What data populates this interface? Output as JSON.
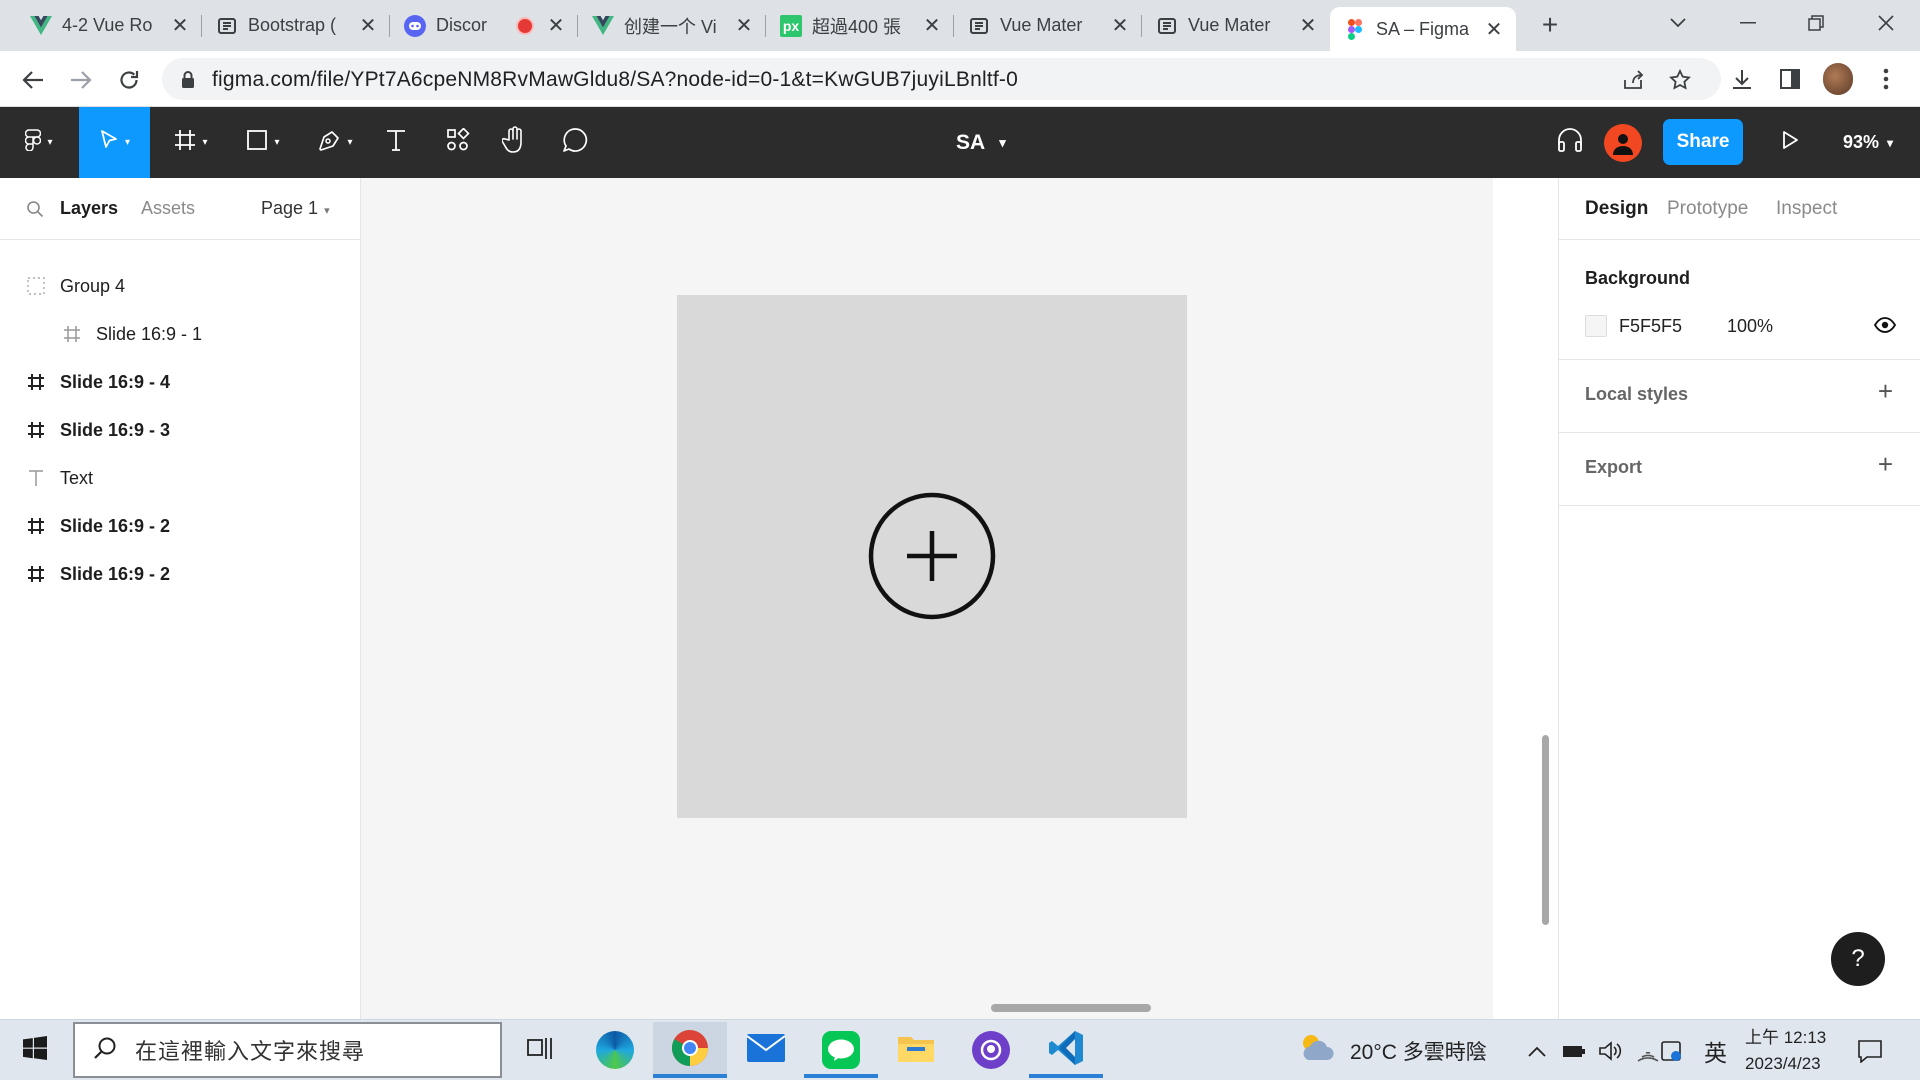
{
  "browser": {
    "tabs": [
      {
        "title": "4-2 Vue Ro",
        "icon": "vue-logo-icon"
      },
      {
        "title": "Bootstrap (",
        "icon": "figma-community-icon"
      },
      {
        "title": "Discor",
        "icon": "discord-icon"
      },
      {
        "title": "创建一个 Vi",
        "icon": "vue-logo-icon"
      },
      {
        "title": "超過400 張",
        "icon": "pixabay-icon",
        "icon_text": "px"
      },
      {
        "title": "Vue Mater",
        "icon": "figma-community-icon"
      },
      {
        "title": "Vue Mater",
        "icon": "figma-community-icon"
      },
      {
        "title": "SA – Figma",
        "icon": "figma-logo-icon",
        "active": true
      }
    ],
    "url": "figma.com/file/YPt7A6cpeNM8RvMawGldu8/SA?node-id=0-1&t=KwGUB7juyiLBnltf-0"
  },
  "figma": {
    "doc_name": "SA",
    "share_label": "Share",
    "zoom": "93%",
    "left_panel": {
      "tabs": [
        "Layers",
        "Assets"
      ],
      "page": "Page 1",
      "layers": [
        {
          "name": "Group 4",
          "type": "group"
        },
        {
          "name": "Slide 16:9 - 1",
          "type": "frame"
        },
        {
          "name": "Slide 16:9 - 4",
          "type": "frame"
        },
        {
          "name": "Slide 16:9 - 3",
          "type": "frame"
        },
        {
          "name": "Text",
          "type": "text"
        },
        {
          "name": "Slide 16:9 - 2",
          "type": "frame"
        },
        {
          "name": "Slide 16:9 - 2",
          "type": "frame"
        }
      ]
    },
    "right_panel": {
      "tabs": [
        "Design",
        "Prototype",
        "Inspect"
      ],
      "background_label": "Background",
      "background_hex": "F5F5F5",
      "background_opacity": "100%",
      "local_styles_label": "Local styles",
      "export_label": "Export"
    },
    "colors": {
      "accent": "#0d99ff",
      "toolbar_bg": "#2c2c2c",
      "canvas_bg": "#f5f5f5",
      "frame_fill": "#d9d9d9"
    }
  },
  "taskbar": {
    "search_placeholder": "在這裡輸入文字來搜尋",
    "weather": "20°C 多雲時陰",
    "ime": "英",
    "time": "上午 12:13",
    "date": "2023/4/23"
  }
}
